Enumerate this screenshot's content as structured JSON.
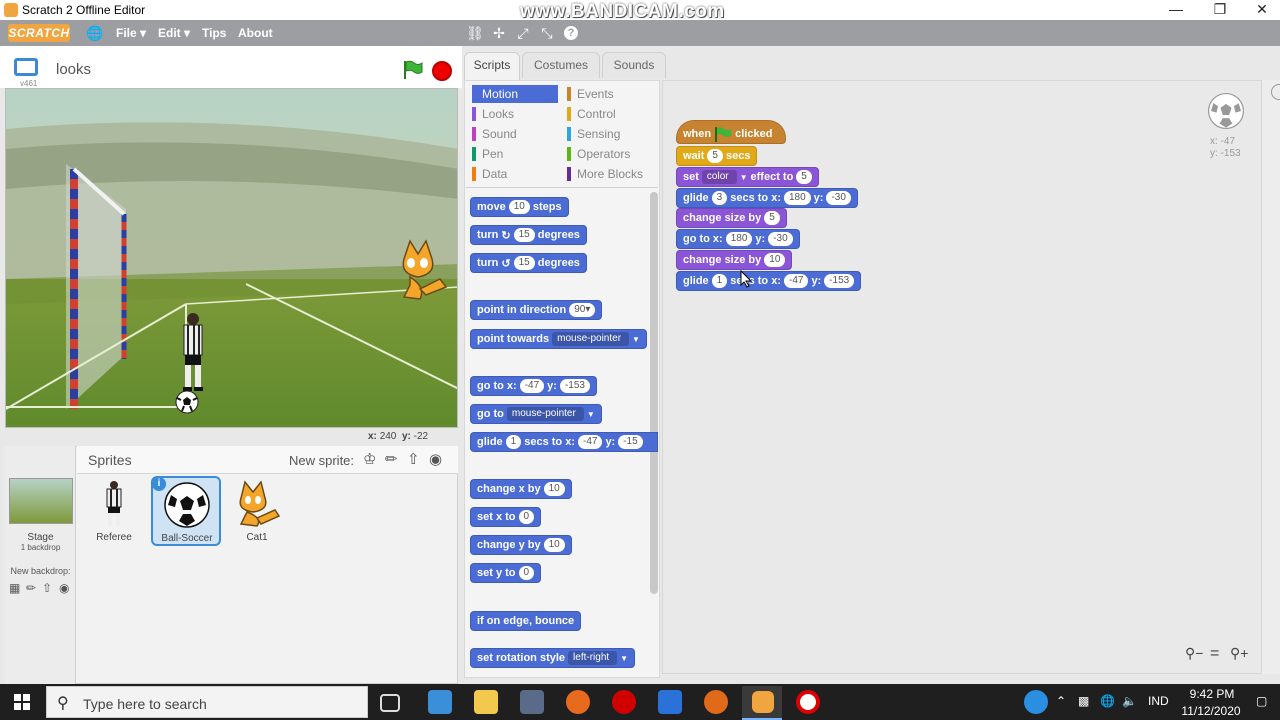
{
  "window": {
    "title": "Scratch 2 Offline Editor",
    "watermark": "www.BANDICAM.com"
  },
  "menubar": {
    "logo": "SCRATCH",
    "menus": [
      "File ▾",
      "Edit ▾",
      "Tips",
      "About"
    ]
  },
  "stage": {
    "project_name": "looks",
    "version": "v461",
    "mouse_x_label": "x:",
    "mouse_x": "240",
    "mouse_y_label": "y:",
    "mouse_y": "-22"
  },
  "sprites": {
    "header": "Sprites",
    "new_sprite_label": "New sprite:",
    "stage_label": "Stage",
    "stage_backdrops": "1 backdrop",
    "new_backdrop_label": "New backdrop:",
    "items": [
      {
        "name": "Referee",
        "selected": false
      },
      {
        "name": "Ball-Soccer",
        "selected": true
      },
      {
        "name": "Cat1",
        "selected": false
      }
    ]
  },
  "tabs": [
    "Scripts",
    "Costumes",
    "Sounds"
  ],
  "categories": [
    {
      "label": "Motion",
      "color": "#4a6cd4",
      "active": true
    },
    {
      "label": "Looks",
      "color": "#8a55d7"
    },
    {
      "label": "Sound",
      "color": "#bb42c3"
    },
    {
      "label": "Pen",
      "color": "#0e9a6c"
    },
    {
      "label": "Data",
      "color": "#ee7d16"
    },
    {
      "label": "Events",
      "color": "#c88330"
    },
    {
      "label": "Control",
      "color": "#e1a91a"
    },
    {
      "label": "Sensing",
      "color": "#2ca5e2"
    },
    {
      "label": "Operators",
      "color": "#5cb712"
    },
    {
      "label": "More Blocks",
      "color": "#632d99"
    }
  ],
  "palette": {
    "move": {
      "a": "move",
      "v": "10",
      "b": "steps"
    },
    "turn_right": {
      "a": "turn",
      "v": "15",
      "b": "degrees"
    },
    "turn_left": {
      "a": "turn",
      "v": "15",
      "b": "degrees"
    },
    "point_dir": {
      "a": "point in direction",
      "v": "90▾"
    },
    "point_towards": {
      "a": "point towards",
      "d": "mouse-pointer"
    },
    "goto_xy": {
      "a": "go to x:",
      "x": "-47",
      "b": "y:",
      "y": "-153"
    },
    "goto": {
      "a": "go to",
      "d": "mouse-pointer"
    },
    "glide": {
      "a": "glide",
      "s": "1",
      "b": "secs to x:",
      "x": "-47",
      "c": "y:",
      "y": "-15"
    },
    "change_x": {
      "a": "change x by",
      "v": "10"
    },
    "set_x": {
      "a": "set x to",
      "v": "0"
    },
    "change_y": {
      "a": "change y by",
      "v": "10"
    },
    "set_y": {
      "a": "set y to",
      "v": "0"
    },
    "bounce": {
      "a": "if on edge, bounce"
    },
    "rotation": {
      "a": "set rotation style",
      "d": "left-right"
    }
  },
  "script": {
    "hat": {
      "a": "when",
      "b": "clicked"
    },
    "wait": {
      "a": "wait",
      "v": "5",
      "b": "secs"
    },
    "set_effect": {
      "a": "set",
      "d": "color",
      "b": "effect to",
      "v": "5"
    },
    "glide1": {
      "a": "glide",
      "s": "3",
      "b": "secs to x:",
      "x": "180",
      "c": "y:",
      "y": "-30"
    },
    "change_size1": {
      "a": "change size by",
      "v": "5"
    },
    "goto1": {
      "a": "go to x:",
      "x": "180",
      "b": "y:",
      "y": "-30"
    },
    "change_size2": {
      "a": "change size by",
      "v": "10"
    },
    "glide2": {
      "a": "glide",
      "s": "1",
      "b": "secs to x:",
      "x": "-47",
      "c": "y:",
      "y": "-153"
    }
  },
  "sprite_info": {
    "x": "x: -47",
    "y": "y: -153"
  },
  "taskbar": {
    "search_placeholder": "Type here to search",
    "lang": "IND",
    "time": "9:42 PM",
    "date": "11/12/2020"
  }
}
